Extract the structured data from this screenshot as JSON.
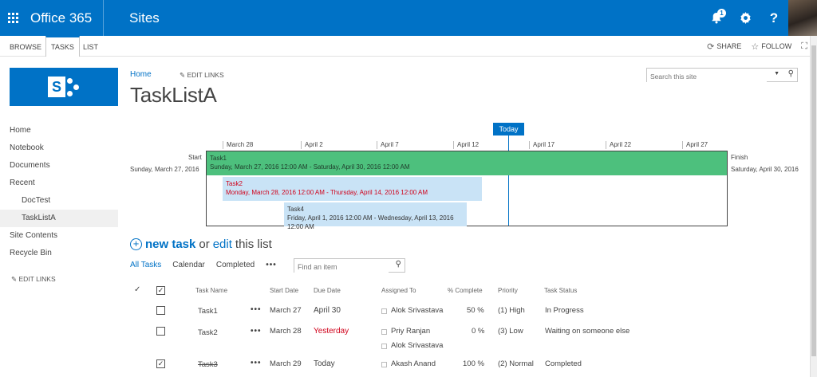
{
  "suite": {
    "brand": "Office 365",
    "app": "Sites",
    "notification_count": "1",
    "icons": [
      "app-launcher-icon",
      "bell-icon",
      "gear-icon",
      "help-icon"
    ]
  },
  "ribbon": {
    "tabs": [
      "BROWSE",
      "TASKS",
      "LIST"
    ],
    "active_tab": "TASKS",
    "share": "SHARE",
    "follow": "FOLLOW"
  },
  "nav": {
    "items": [
      {
        "label": "Home",
        "level": 0
      },
      {
        "label": "Notebook",
        "level": 0
      },
      {
        "label": "Documents",
        "level": 0
      },
      {
        "label": "Recent",
        "level": 0
      },
      {
        "label": "DocTest",
        "level": 1
      },
      {
        "label": "TaskListA",
        "level": 1,
        "selected": true
      },
      {
        "label": "Site Contents",
        "level": 0
      },
      {
        "label": "Recycle Bin",
        "level": 0
      }
    ],
    "edit_links": "EDIT LINKS"
  },
  "header": {
    "home": "Home",
    "edit_links": "EDIT LINKS",
    "title": "TaskListA",
    "search_placeholder": "Search this site"
  },
  "timeline": {
    "today": "Today",
    "ticks": [
      "March 28",
      "April 2",
      "April 7",
      "April 12",
      "April 17",
      "April 22",
      "April 27"
    ],
    "start_label": "Start",
    "start_date": "Sunday, March 27, 2016",
    "finish_label": "Finish",
    "finish_date": "Saturday, April 30, 2016",
    "bars": [
      {
        "name": "Task1",
        "dates": "Sunday, March 27, 2016 12:00 AM - Saturday, April 30, 2016 12:00 AM"
      },
      {
        "name": "Task2",
        "dates": "Monday, March 28, 2016 12:00 AM - Thursday, April 14, 2016 12:00 AM"
      },
      {
        "name": "Task4",
        "dates": "Friday, April 1, 2016 12:00 AM - Wednesday, April 13, 2016 12:00 AM"
      }
    ]
  },
  "list": {
    "new_task": "new task",
    "or": "or",
    "edit": "edit",
    "this_list": "this list",
    "views": [
      "All Tasks",
      "Calendar",
      "Completed"
    ],
    "more": "•••",
    "find_placeholder": "Find an item",
    "columns": [
      "Task Name",
      "Start Date",
      "Due Date",
      "Assigned To",
      "% Complete",
      "Priority",
      "Task Status"
    ],
    "rows": [
      {
        "name": "Task1",
        "start": "March 27",
        "due": "April 30",
        "assigned": [
          "Alok Srivastava"
        ],
        "pct": "50 %",
        "priority": "(1) High",
        "status": "In Progress",
        "checked": false
      },
      {
        "name": "Task2",
        "start": "March 28",
        "due": "Yesterday",
        "assigned": [
          "Priy Ranjan",
          "Alok Srivastava"
        ],
        "pct": "0 %",
        "priority": "(3) Low",
        "status": "Waiting on someone else",
        "checked": false
      },
      {
        "name": "Task3",
        "start": "March 29",
        "due": "Today",
        "assigned": [
          "Akash Anand"
        ],
        "pct": "100 %",
        "priority": "(2) Normal",
        "status": "Completed",
        "checked": true
      }
    ]
  },
  "colors": {
    "accent": "#0072c6",
    "task1_bar": "#4dc07d",
    "task_bar": "#c9e3f6",
    "overdue": "#d0021b"
  }
}
